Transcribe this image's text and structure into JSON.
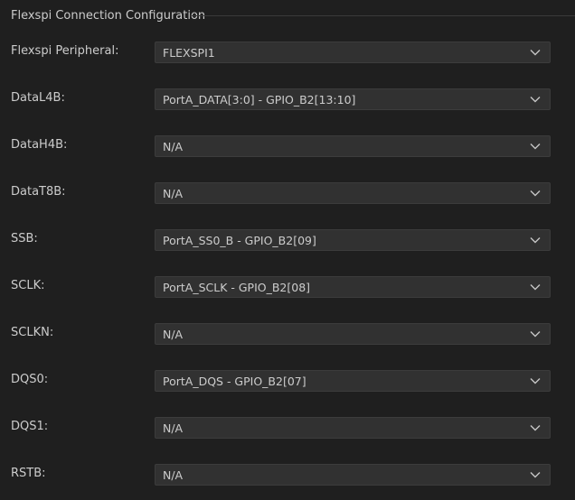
{
  "section": {
    "title": "Flexspi Connection Configuration"
  },
  "fields": [
    {
      "label": "Flexspi Peripheral:",
      "value": "FLEXSPI1",
      "icon": "chevron-down-icon"
    },
    {
      "label": "DataL4B:",
      "value": "PortA_DATA[3:0] - GPIO_B2[13:10]",
      "icon": "chevron-down-icon"
    },
    {
      "label": "DataH4B:",
      "value": "N/A",
      "icon": "chevron-down-icon"
    },
    {
      "label": "DataT8B:",
      "value": "N/A",
      "icon": "chevron-down-icon"
    },
    {
      "label": "SSB:",
      "value": "PortA_SS0_B - GPIO_B2[09]",
      "icon": "chevron-down-icon"
    },
    {
      "label": "SCLK:",
      "value": "PortA_SCLK - GPIO_B2[08]",
      "icon": "chevron-down-icon"
    },
    {
      "label": "SCLKN:",
      "value": "N/A",
      "icon": "chevron-down-icon"
    },
    {
      "label": "DQS0:",
      "value": "PortA_DQS - GPIO_B2[07]",
      "icon": "chevron-down-icon"
    },
    {
      "label": "DQS1:",
      "value": "N/A",
      "icon": "chevron-down-icon"
    },
    {
      "label": "RSTB:",
      "value": "N/A",
      "icon": "chevron-down-icon"
    }
  ],
  "colors": {
    "background": "#1f1f1f",
    "select_background": "#313131",
    "select_border": "#3c3c3c",
    "text": "#cccccc",
    "chevron": "#c5c5c5"
  }
}
